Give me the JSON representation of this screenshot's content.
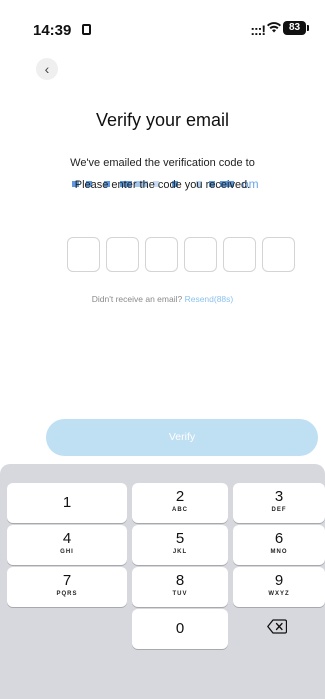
{
  "status_bar": {
    "time": "14:39",
    "signal": ":::!",
    "wifi": "wifi-icon",
    "battery": "83"
  },
  "header": {
    "back_icon": "chevron-left-icon"
  },
  "title": "Verify your email",
  "info_text": "We've emailed the verification code to",
  "email_suffix": "om",
  "instruction_text": "Please enter the code you received.",
  "code_length": 6,
  "resend": {
    "prefix": "Didn't receive an email?",
    "link": "Resend(88s)"
  },
  "verify_button": {
    "label": "Verify"
  },
  "colors": {
    "accent": "#8cc2ef",
    "button_disabled": "#bfdff2",
    "keyboard_bg": "#d7d8dd"
  },
  "keyboard": {
    "keys": [
      {
        "digit": "1",
        "letters": ""
      },
      {
        "digit": "2",
        "letters": "ABC"
      },
      {
        "digit": "3",
        "letters": "DEF"
      },
      {
        "digit": "4",
        "letters": "GHI"
      },
      {
        "digit": "5",
        "letters": "JKL"
      },
      {
        "digit": "6",
        "letters": "MNO"
      },
      {
        "digit": "7",
        "letters": "PQRS"
      },
      {
        "digit": "8",
        "letters": "TUV"
      },
      {
        "digit": "9",
        "letters": "WXYZ"
      },
      {
        "digit": "0",
        "letters": ""
      }
    ],
    "delete_icon": "backspace-icon"
  }
}
